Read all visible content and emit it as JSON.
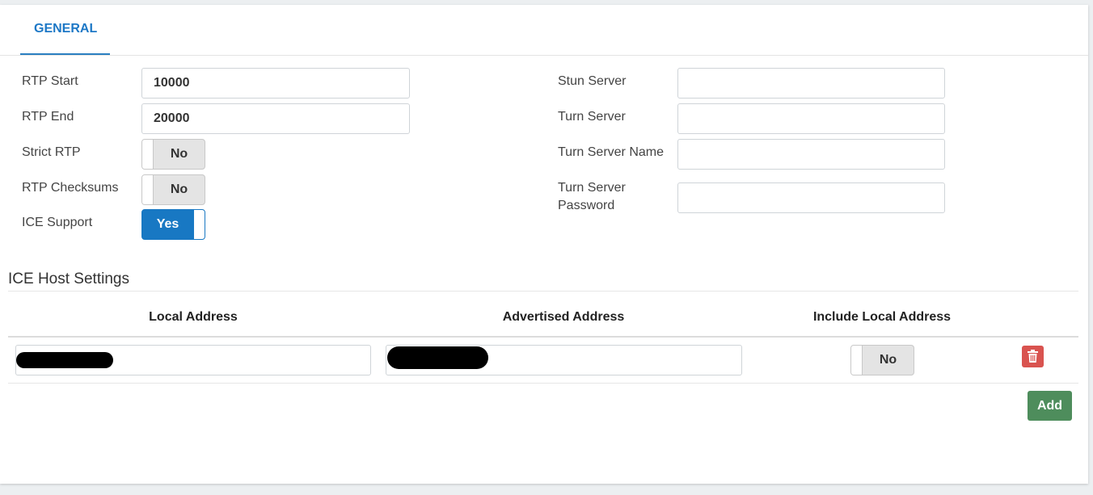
{
  "tabs": [
    {
      "label": "GENERAL",
      "active": true
    }
  ],
  "left_fields": {
    "rtp_start": {
      "label": "RTP Start",
      "value": "10000"
    },
    "rtp_end": {
      "label": "RTP End",
      "value": "20000"
    },
    "strict_rtp": {
      "label": "Strict RTP",
      "value": "No",
      "on": false
    },
    "rtp_checksums": {
      "label": "RTP Checksums",
      "value": "No",
      "on": false
    },
    "ice_support": {
      "label": "ICE Support",
      "value": "Yes",
      "on": true
    }
  },
  "right_fields": {
    "stun_server": {
      "label": "Stun Server",
      "value": ""
    },
    "turn_server": {
      "label": "Turn Server",
      "value": ""
    },
    "turn_server_name": {
      "label": "Turn Server Name",
      "value": ""
    },
    "turn_server_password": {
      "label_line1": "Turn Server",
      "label_line2": "Password",
      "value": ""
    }
  },
  "ice_host": {
    "title": "ICE Host Settings",
    "columns": [
      "Local Address",
      "Advertised Address",
      "Include Local Address"
    ],
    "rows": [
      {
        "local_address": "",
        "advertised_address": "",
        "include_local": "No",
        "include_local_on": false
      }
    ],
    "add_label": "Add"
  },
  "colors": {
    "accent": "#1d78c6",
    "toggle_on": "#1878c3",
    "delete": "#d9534f",
    "add": "#4e8d5c"
  },
  "icons": {
    "delete": "trash-icon"
  }
}
